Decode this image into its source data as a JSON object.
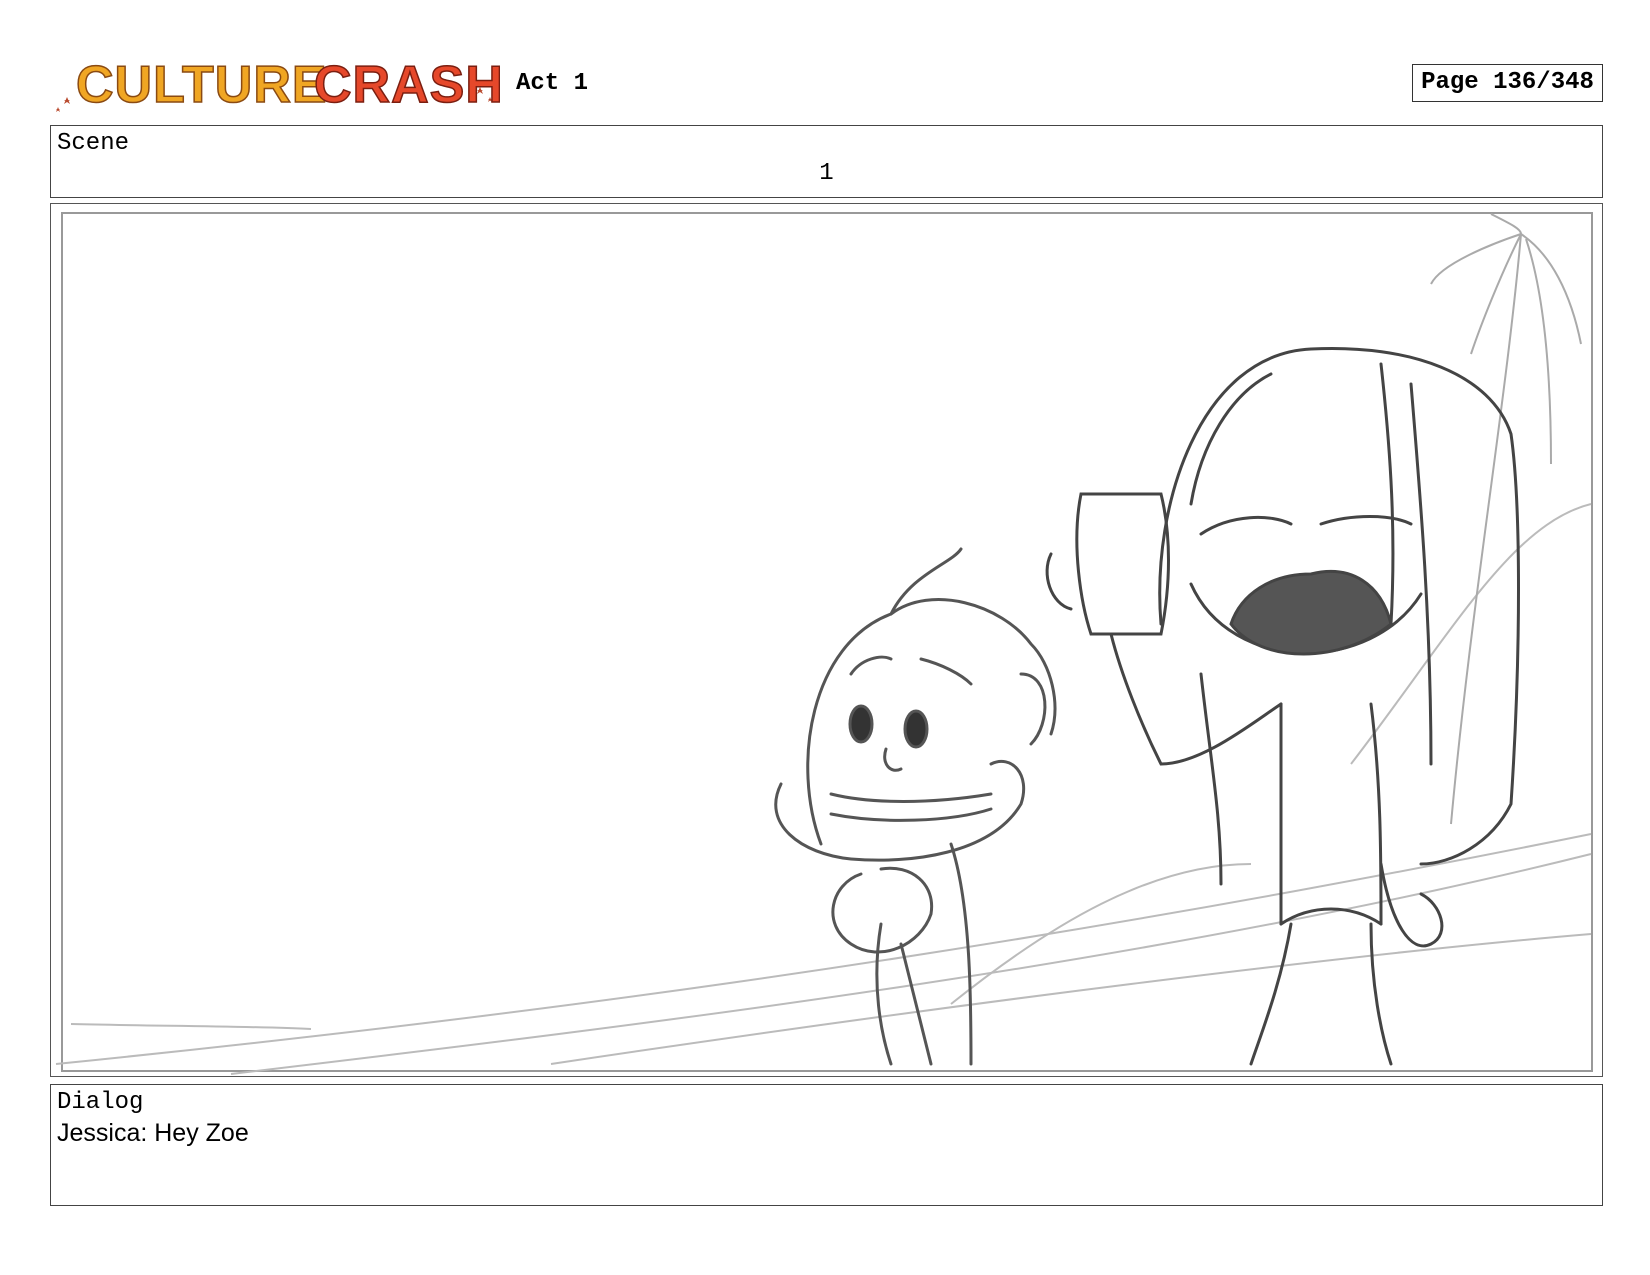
{
  "header": {
    "logo_text": "CULTURE CRASH",
    "act": "Act 1",
    "page": "Page 136/348"
  },
  "scene": {
    "label": "Scene",
    "number": "1"
  },
  "panel": {
    "image_subject": "storyboard-sketch"
  },
  "dialog": {
    "label": "Dialog",
    "text": "Jessica: Hey Zoe"
  },
  "colors": {
    "logo_orange": "#f0a623",
    "logo_red": "#e6482a",
    "sketch_line": "#444444",
    "border": "#444444"
  }
}
